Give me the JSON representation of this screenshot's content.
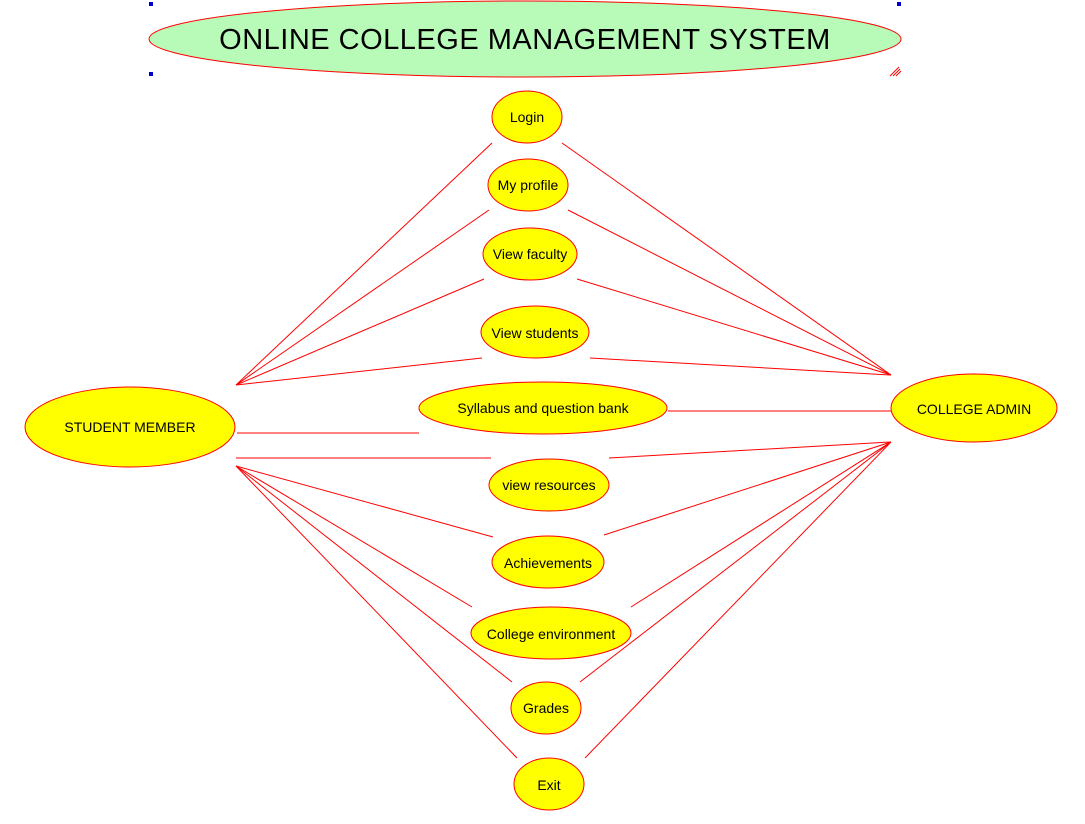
{
  "diagram": {
    "title": "ONLINE COLLEGE MANAGEMENT SYSTEM",
    "actors": {
      "student": "STUDENT MEMBER",
      "admin": "COLLEGE ADMIN"
    },
    "use_cases": [
      "Login",
      "My profile",
      "View faculty",
      "View students",
      "Syllabus and question bank",
      "view resources",
      "Achievements",
      "College environment",
      "Grades",
      "Exit"
    ],
    "colors": {
      "node_fill": "#ffff00",
      "title_fill": "#b8fbb8",
      "line": "#ff0000",
      "selection_handle": "#0000cc"
    }
  }
}
